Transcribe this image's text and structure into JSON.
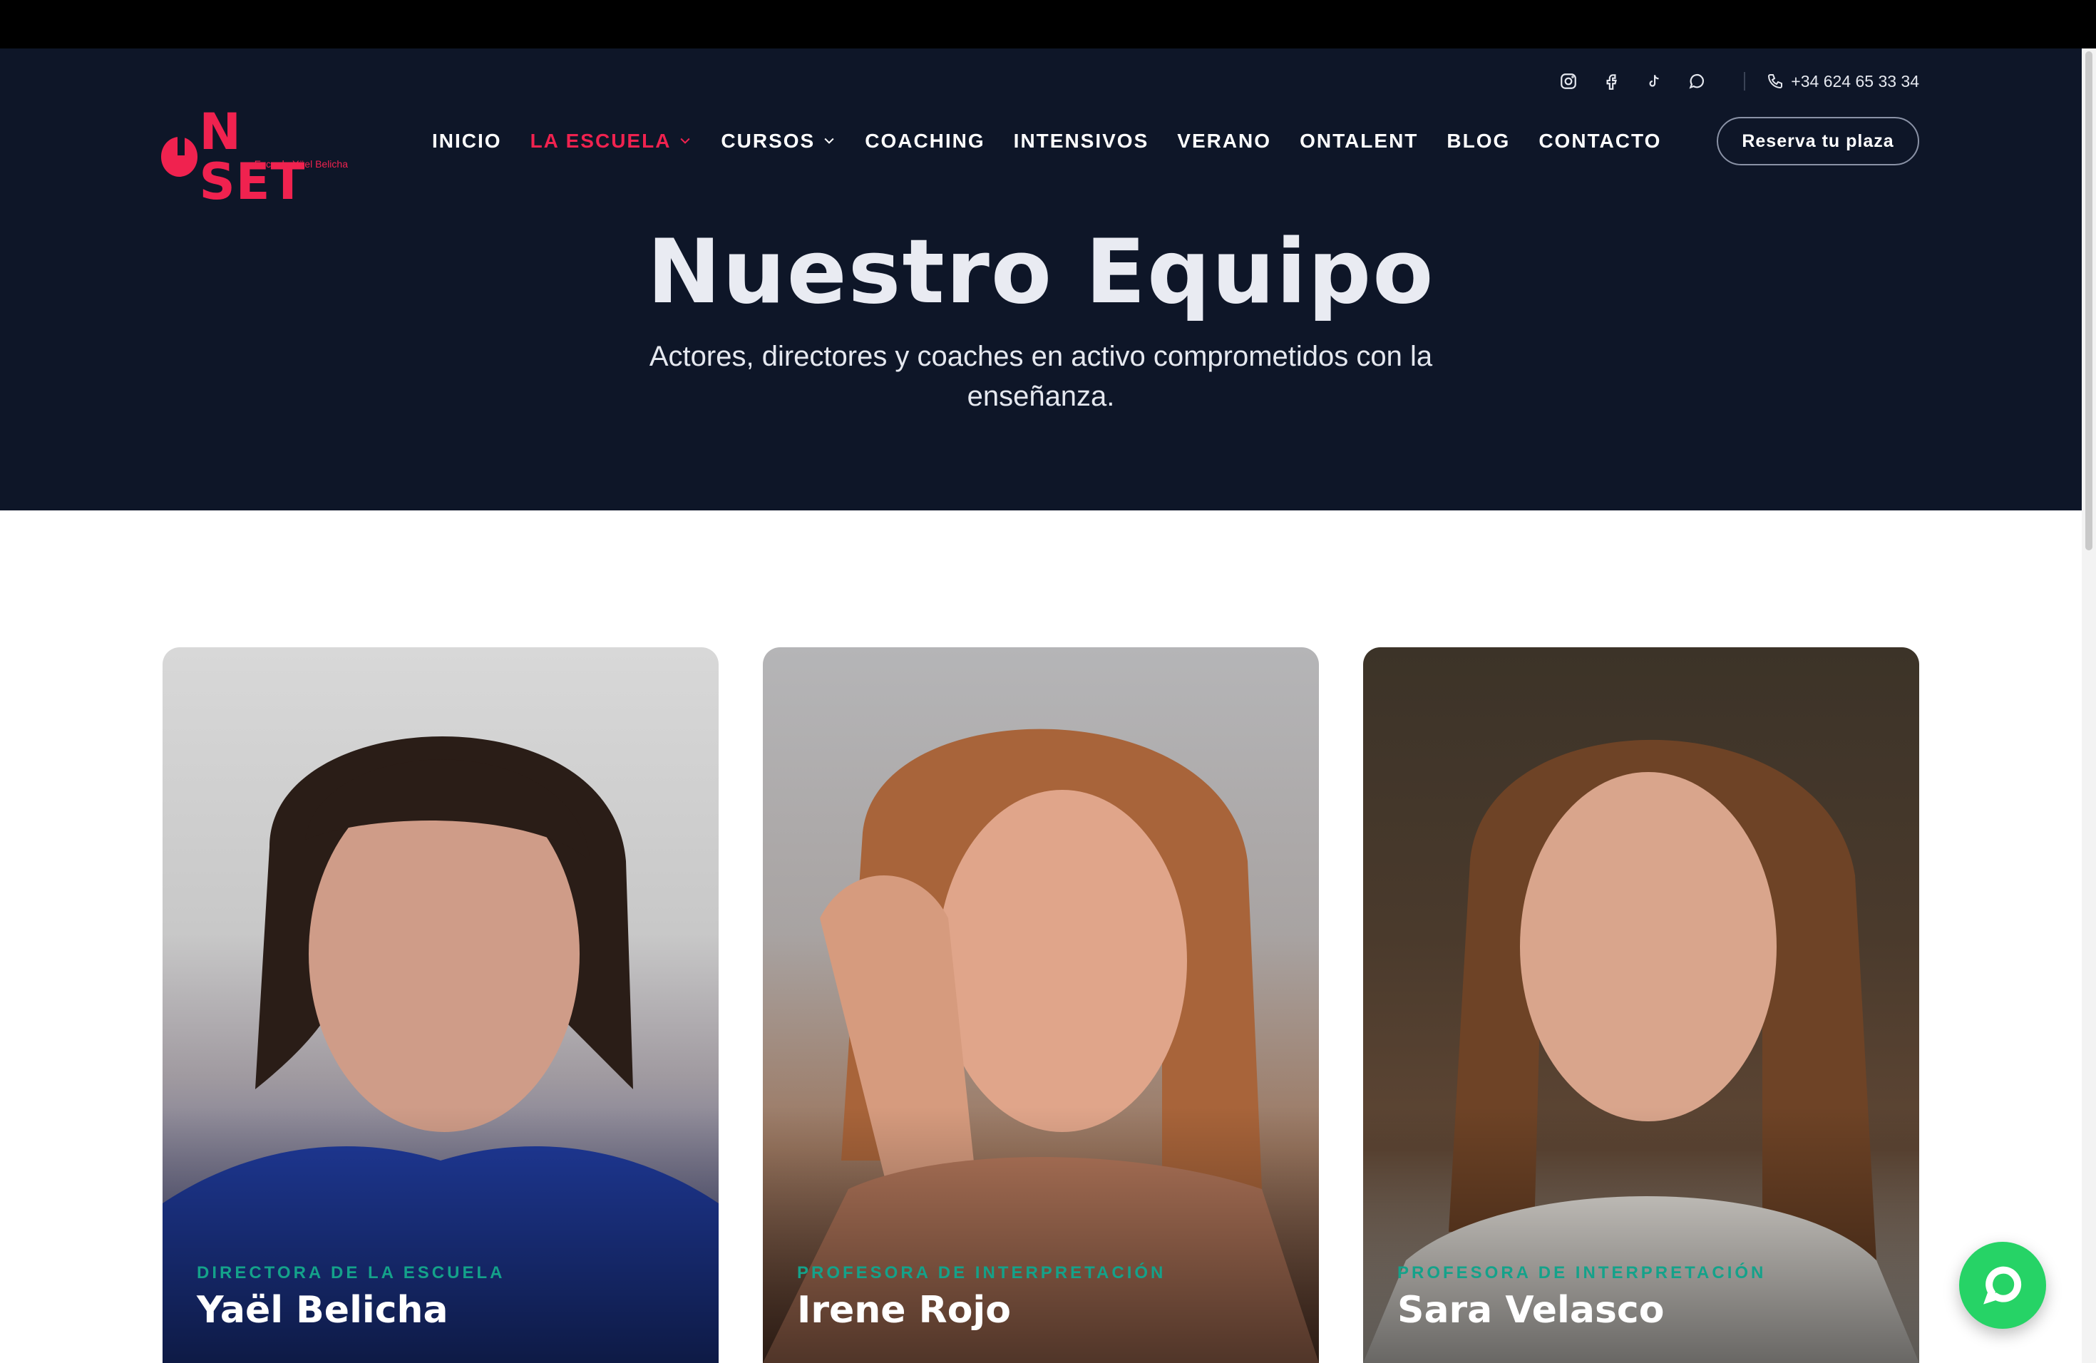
{
  "header": {
    "logo": {
      "text": "ON SET",
      "subtitle": "Escuela Yäel Belicha"
    },
    "social_icons": [
      "instagram-icon",
      "facebook-icon",
      "tiktok-icon",
      "whatsapp-icon"
    ],
    "phone": "+34 624 65 33 34",
    "nav": [
      {
        "label": "INICIO",
        "has_dropdown": false,
        "active": false
      },
      {
        "label": "LA ESCUELA",
        "has_dropdown": true,
        "active": true
      },
      {
        "label": "CURSOS",
        "has_dropdown": true,
        "active": false
      },
      {
        "label": "COACHING",
        "has_dropdown": false,
        "active": false
      },
      {
        "label": "INTENSIVOS",
        "has_dropdown": false,
        "active": false
      },
      {
        "label": "VERANO",
        "has_dropdown": false,
        "active": false
      },
      {
        "label": "ONTALENT",
        "has_dropdown": false,
        "active": false
      },
      {
        "label": "BLOG",
        "has_dropdown": false,
        "active": false
      },
      {
        "label": "CONTACTO",
        "has_dropdown": false,
        "active": false
      }
    ],
    "cta_label": "Reserva tu plaza"
  },
  "hero": {
    "title": "Nuestro Equipo",
    "subtitle": "Actores, directores y coaches en activo comprometidos con la enseñanza."
  },
  "team": [
    {
      "role": "DIRECTORA DE LA ESCUELA",
      "name": "Yaël Belicha"
    },
    {
      "role": "PROFESORA DE INTERPRETACIÓN",
      "name": "Irene Rojo"
    },
    {
      "role": "PROFESORA DE INTERPRETACIÓN",
      "name": "Sara Velasco"
    }
  ],
  "colors": {
    "brand": "#f0224f",
    "hero_bg": "#0e1628",
    "role_text": "#14a28a",
    "chat_button": "#26d366"
  },
  "chat_icon": "chat-bubble-icon"
}
